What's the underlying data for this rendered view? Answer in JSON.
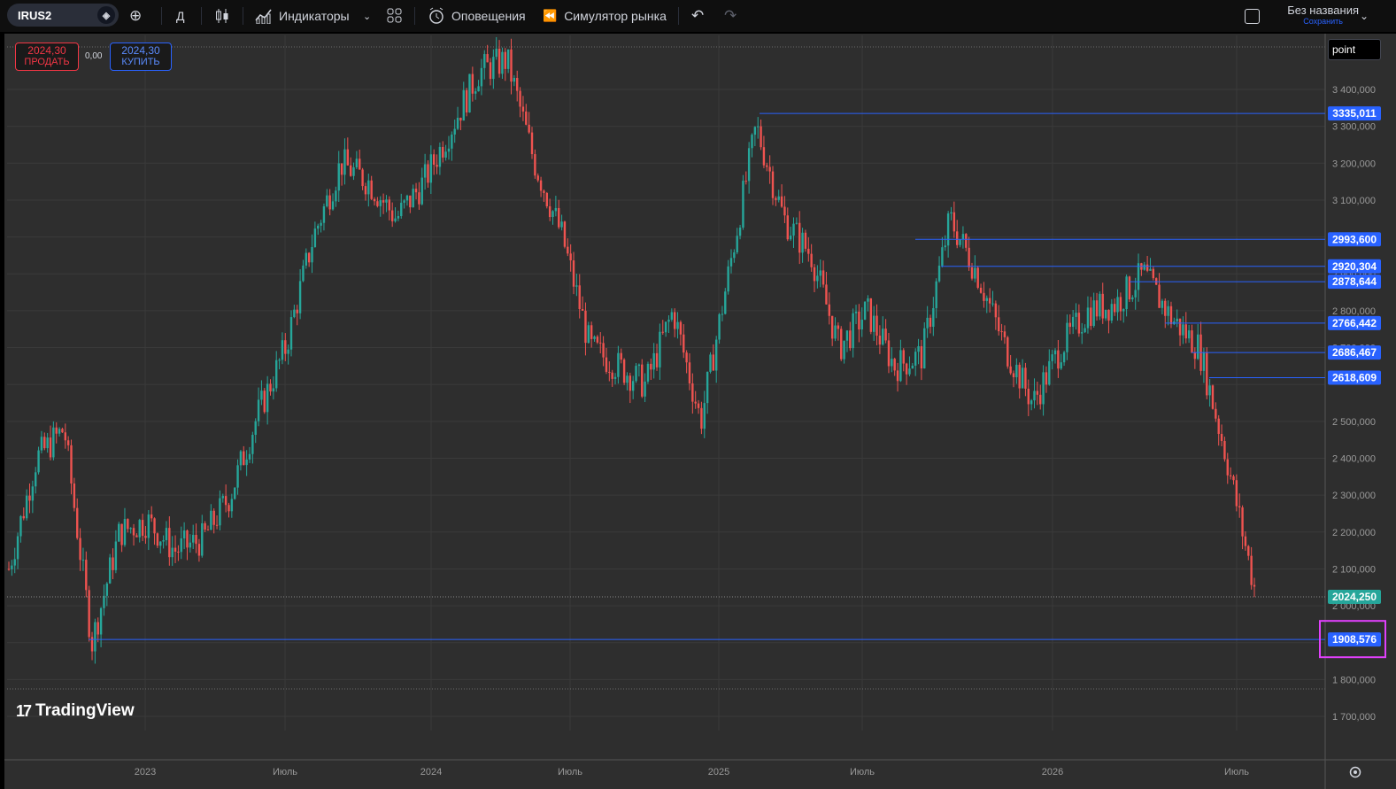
{
  "toolbar": {
    "symbol": "IRUS2",
    "interval": "Д",
    "indicators": "Индикаторы",
    "alerts": "Оповещения",
    "replay": "Симулятор рынка",
    "layout_title": "Без названия",
    "layout_save": "Сохранить"
  },
  "trade": {
    "sell_price": "2024,30",
    "sell_label": "ПРОДАТЬ",
    "buy_price": "2024,30",
    "buy_label": "КУПИТЬ",
    "spread": "0,00"
  },
  "price_axis": {
    "unit": "point",
    "ticks": [
      "3 400,000",
      "3 300,000",
      "3 200,000",
      "3 100,000",
      "2 900,000",
      "2 800,000",
      "2 700,000",
      "2 500,000",
      "2 400,000",
      "2 300,000",
      "2 200,000",
      "2 100,000",
      "2 000,000",
      "1 800,000",
      "1 700,000"
    ]
  },
  "time_axis": {
    "labels": [
      "2023",
      "Июль",
      "2024",
      "Июль",
      "2025",
      "Июль",
      "2026",
      "Июль"
    ]
  },
  "horizontal_lines": [
    {
      "label": "3335,011",
      "value": 3335.011
    },
    {
      "label": "2993,600",
      "value": 2993.6
    },
    {
      "label": "2920,304",
      "value": 2920.304
    },
    {
      "label": "2878,644",
      "value": 2878.644
    },
    {
      "label": "2766,442",
      "value": 2766.442
    },
    {
      "label": "2686,467",
      "value": 2686.467
    },
    {
      "label": "2618,609",
      "value": 2618.609
    },
    {
      "label": "1908,576",
      "value": 1908.576,
      "highlighted": true
    }
  ],
  "last_price": {
    "label": "2024,250",
    "value": 2024.25
  },
  "logo": "TradingView",
  "colors": {
    "up": "#26a69a",
    "down": "#ef5350",
    "line": "#2962ff",
    "highlight": "#e040fb",
    "last": "#26a69a"
  },
  "chart_data": {
    "type": "candlestick",
    "y_unit": "point",
    "ylim": [
      1650,
      3500
    ],
    "x": [
      "2022-10",
      "2022-11",
      "2022-12",
      "2023-01",
      "2023-02",
      "2023-03",
      "2023-04",
      "2023-05",
      "2023-06",
      "2023-07",
      "2023-08",
      "2023-09",
      "2023-10",
      "2023-11",
      "2023-12",
      "2024-01",
      "2024-02",
      "2024-03",
      "2024-04",
      "2024-05",
      "2024-06",
      "2024-07",
      "2024-08",
      "2024-09",
      "2024-10",
      "2024-11",
      "2024-12",
      "2025-01",
      "2025-02",
      "2025-03",
      "2025-04",
      "2025-05",
      "2025-06",
      "2025-07",
      "2025-08",
      "2025-09",
      "2025-10",
      "2025-11",
      "2025-12",
      "2026-01",
      "2026-02",
      "2026-03",
      "2026-04",
      "2026-05",
      "2026-06",
      "2026-07"
    ],
    "close": [
      2100,
      2400,
      2480,
      1900,
      2200,
      2230,
      2150,
      2180,
      2300,
      2520,
      2700,
      3000,
      3200,
      3150,
      3050,
      3150,
      3300,
      3450,
      3480,
      3200,
      3000,
      2700,
      2650,
      2600,
      2800,
      2500,
      2900,
      3300,
      3050,
      2950,
      2700,
      2800,
      2650,
      2680,
      3050,
      2900,
      2700,
      2550,
      2700,
      2800,
      2820,
      2900,
      2780,
      2700,
      2400,
      2050
    ],
    "series": [
      {
        "name": "IRUS2",
        "values": [
          2100,
          2400,
          2480,
          1900,
          2200,
          2230,
          2150,
          2180,
          2300,
          2520,
          2700,
          3000,
          3200,
          3150,
          3050,
          3150,
          3300,
          3450,
          3480,
          3200,
          3000,
          2700,
          2650,
          2600,
          2800,
          2500,
          2900,
          3300,
          3050,
          2950,
          2700,
          2800,
          2650,
          2680,
          3050,
          2900,
          2700,
          2550,
          2700,
          2800,
          2820,
          2900,
          2780,
          2700,
          2400,
          2050
        ]
      }
    ]
  }
}
